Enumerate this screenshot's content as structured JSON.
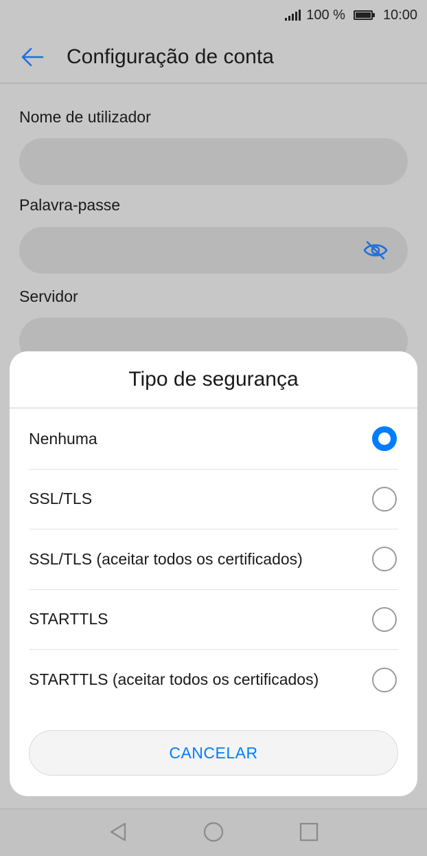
{
  "status_bar": {
    "battery_percent": "100 %",
    "time": "10:00"
  },
  "app_bar": {
    "title": "Configuração de conta"
  },
  "form": {
    "username_label": "Nome de utilizador",
    "password_label": "Palavra-passe",
    "server_label": "Servidor"
  },
  "dialog": {
    "title": "Tipo de segurança",
    "options": [
      {
        "label": "Nenhuma",
        "selected": true
      },
      {
        "label": "SSL/TLS",
        "selected": false
      },
      {
        "label": "SSL/TLS (aceitar todos os certificados)",
        "selected": false
      },
      {
        "label": "STARTTLS",
        "selected": false
      },
      {
        "label": "STARTTLS (aceitar todos os certificados)",
        "selected": false
      }
    ],
    "cancel_label": "CANCELAR"
  },
  "colors": {
    "accent": "#007dff",
    "scrim": "#c7c7c7"
  },
  "icons": [
    "signal-icon",
    "battery-icon",
    "back-arrow-icon",
    "eye-off-icon",
    "nav-back-icon",
    "nav-home-icon",
    "nav-recent-icon"
  ]
}
